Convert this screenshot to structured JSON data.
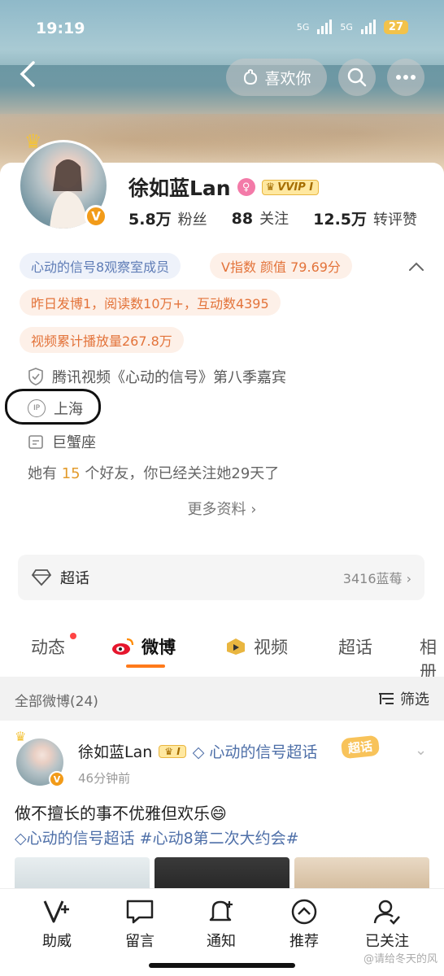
{
  "status_bar": {
    "time": "19:19",
    "signal1": "5G",
    "signal2": "5G",
    "battery": "27"
  },
  "nav": {
    "like_label": "喜欢你"
  },
  "profile": {
    "name": "徐如蓝Lan",
    "vip_label": "VVIP I",
    "stats": [
      {
        "value": "5.8万",
        "label": "粉丝"
      },
      {
        "value": "88",
        "label": "关注"
      },
      {
        "value": "12.5万",
        "label": "转评赞"
      }
    ],
    "tags": {
      "observer": "心动的信号8观察室成员",
      "v_index": "V指数 颜值 79.69分",
      "yesterday": "昨日发博1，阅读数10万+，互动数4395",
      "video_plays": "视频累计播放量267.8万"
    },
    "verified": "腾讯视频《心动的信号》第八季嘉宾",
    "ip_icon": "IP",
    "ip": "上海",
    "zodiac": "巨蟹座",
    "friends_prefix": "她有",
    "friends_count": "15",
    "friends_suffix": "个好友，你已经关注她29天了",
    "more_info": "更多资料"
  },
  "super_topic": {
    "label": "超话",
    "count": "3416蓝莓"
  },
  "tabs": [
    {
      "label": "动态"
    },
    {
      "label": "微博"
    },
    {
      "label": "视频"
    },
    {
      "label": "超话"
    },
    {
      "label": "相册"
    }
  ],
  "filter": {
    "all_label": "全部微博(24)",
    "filter_label": "筛选"
  },
  "post": {
    "author": "徐如蓝Lan",
    "vip_label": "I",
    "topic": "心动的信号超话",
    "super_tag": "超话",
    "time": "46分钟前",
    "text": "做不擅长的事不优雅但欢乐😄",
    "links": "心动的信号超话 #心动8第二次大约会#"
  },
  "bottom_bar": [
    {
      "label": "助威",
      "icon": "v-plus-icon"
    },
    {
      "label": "留言",
      "icon": "comment-icon"
    },
    {
      "label": "通知",
      "icon": "bell-plus-icon"
    },
    {
      "label": "推荐",
      "icon": "chevron-up-circle-icon"
    },
    {
      "label": "已关注",
      "icon": "user-check-icon"
    }
  ],
  "watermark": "@请给冬天的风"
}
